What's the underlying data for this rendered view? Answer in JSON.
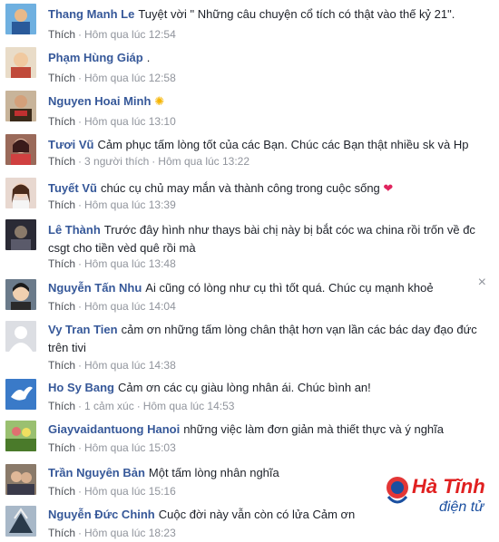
{
  "comments": [
    {
      "name": "Thang Manh Le",
      "text": "Tuyệt vời \" Những câu chuyện cổ tích có thật vào thế kỷ 21\".",
      "like": "Thích",
      "extra": "",
      "time": "Hôm qua lúc 12:54",
      "avatar_color": "#3a6ea5"
    },
    {
      "name": "Phạm Hùng Giáp",
      "text": ".",
      "like": "Thích",
      "extra": "",
      "time": "Hôm qua lúc 12:58",
      "avatar_color": "#c9a46a"
    },
    {
      "name": "Nguyen Hoai Minh",
      "text": "",
      "like": "Thích",
      "extra": "",
      "time": "Hôm qua lúc 13:10",
      "avatar_color": "#7a4a2a"
    },
    {
      "name": "Tươi Vũ",
      "text": "Cảm phục tấm lòng tốt của các Bạn. Chúc các Bạn thật nhiều sk và Hp",
      "like": "Thích",
      "extra": "3 người thích",
      "time": "Hôm qua lúc 13:22",
      "avatar_color": "#b86a6a"
    },
    {
      "name": "Tuyết Vũ",
      "text": "chúc cụ chủ may mắn và thành công trong cuộc sống",
      "like": "Thích",
      "extra": "",
      "time": "Hôm qua lúc 13:39",
      "avatar_color": "#d9a08c"
    },
    {
      "name": "Lê Thành",
      "text": "Trước đây hình như thays bài chị này bị bắt cóc wa china rồi trốn về đc csgt cho tiền vèd quê rồi mà",
      "like": "Thích",
      "extra": "",
      "time": "Hôm qua lúc 13:48",
      "avatar_color": "#4a4a5a"
    },
    {
      "name": "Nguyễn Tấn Nhu",
      "text": "Ai cũng có lòng như cụ thì tốt quá. Chúc cụ mạnh khoẻ",
      "like": "Thích",
      "extra": "",
      "time": "Hôm qua lúc 14:04",
      "avatar_color": "#3a3a3a"
    },
    {
      "name": "Vy Tran Tien",
      "text": "cảm ơn những tấm lòng chân thật hơn vạn lần các bác day đạo đức trên tivi",
      "like": "Thích",
      "extra": "",
      "time": "Hôm qua lúc 14:38",
      "avatar_color": "#d8dadf"
    },
    {
      "name": "Ho Sy Bang",
      "text": "Cảm ơn các cụ giàu lòng nhân ái. Chúc bình an!",
      "like": "Thích",
      "extra": "1 cảm xúc",
      "time": "Hôm qua lúc 14:53",
      "avatar_color": "#2f6db5"
    },
    {
      "name": "Giayvaidantuong Hanoi",
      "text": "những việc làm đơn giản mà thiết thực và ý nghĩa",
      "like": "Thích",
      "extra": "",
      "time": "Hôm qua lúc 15:03",
      "avatar_color": "#5a8a3a"
    },
    {
      "name": "Trần Nguyên Bản",
      "text": "Một tấm lòng nhân nghĩa",
      "like": "Thích",
      "extra": "",
      "time": "Hôm qua lúc 15:16",
      "avatar_color": "#6a5a4a"
    },
    {
      "name": "Nguyễn Đức Chinh",
      "text": "Cuộc đời này vẫn còn có lửa Cảm ơn",
      "like": "Thích",
      "extra": "",
      "time": "Hôm qua lúc 18:23",
      "avatar_color": "#2a3a4a"
    }
  ],
  "close_label": "×",
  "logo": {
    "brand": "Hà Tĩnh",
    "sub": "điện tử",
    "red": "#e02020",
    "blue": "#1a4fa0"
  }
}
